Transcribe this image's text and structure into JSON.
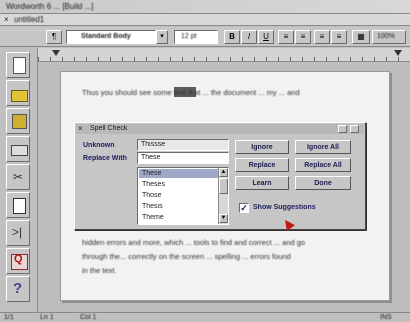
{
  "window": {
    "title": "Wordworth 6 ... [Build ...]",
    "document_title": "untitled1"
  },
  "toolbar": {
    "style_value": "Standard Body",
    "font_size": "12 pt",
    "zoom": "100%"
  },
  "document": {
    "lines": [
      "Thus you should see some text that ... the document ... my ... and",
      "",
      "",
      "",
      "",
      "",
      "hidden errors and more, which ... tools to find and correct ... and go",
      "through the... correctly on the screen ... spelling ... errors found",
      "in the text."
    ]
  },
  "spell_dialog": {
    "title": "Spell Check",
    "not_found_label": "Unknown",
    "not_found_value": "Thissse",
    "replace_label": "Replace With",
    "replace_value": "These",
    "suggestions": [
      "These",
      "Theses",
      "Those",
      "Thesis",
      "Theme"
    ],
    "buttons": {
      "ignore": "Ignore",
      "ignore_all": "Ignore All",
      "replace": "Replace",
      "replace_all": "Replace All",
      "learn": "Learn",
      "done": "Done"
    },
    "checkbox_label": "Show Suggestions",
    "checkbox_checked": true
  },
  "status_bar": {
    "page": "1/1",
    "line": "Ln 1",
    "col": "Col 1",
    "mode": "INS"
  }
}
